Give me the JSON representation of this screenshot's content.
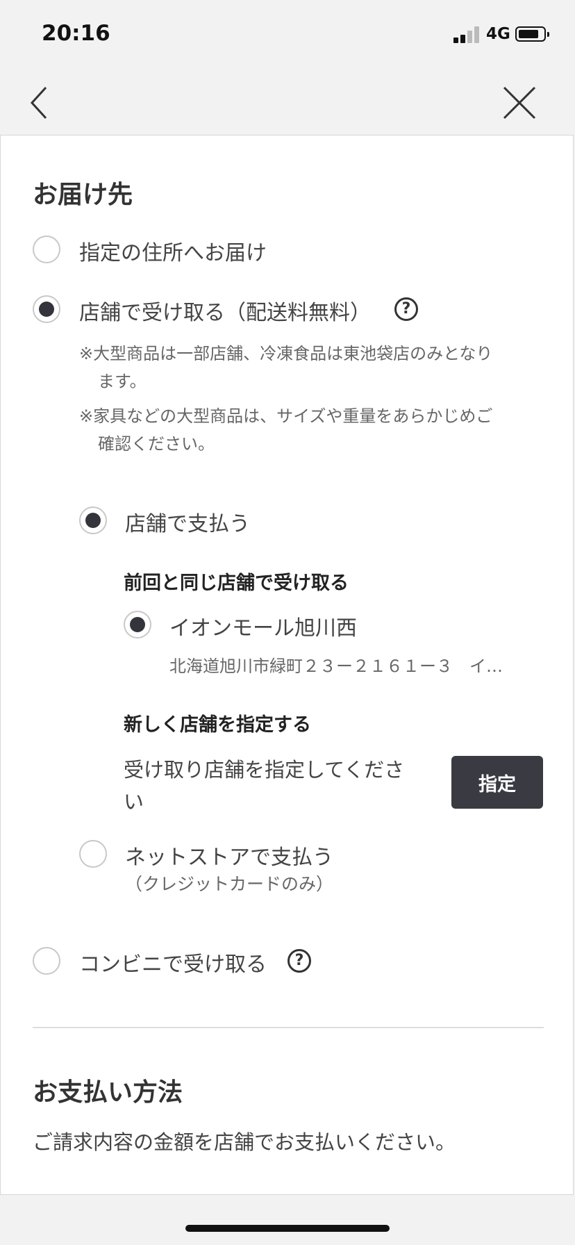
{
  "status_bar": {
    "time": "20:16",
    "network": "4G"
  },
  "delivery": {
    "title": "お届け先",
    "options": [
      {
        "label": "指定の住所へお届け",
        "selected": false
      },
      {
        "label": "店舗で受け取る（配送料無料）",
        "selected": true
      },
      {
        "label": "コンビニで受け取る",
        "selected": false
      }
    ],
    "notes": [
      [
        "※大型商品は一部店舗、冷凍食品は東池袋店のみとなり",
        "ます。"
      ],
      [
        "※家具などの大型商品は、サイズや重量をあらかじめご",
        "確認ください。"
      ]
    ],
    "payment_options": [
      {
        "label": "店舗で支払う",
        "selected": true
      },
      {
        "label": "ネットストアで支払う",
        "sub": "（クレジットカードのみ）",
        "selected": false
      }
    ],
    "same_store": {
      "heading": "前回と同じ店舗で受け取る",
      "store_name": "イオンモール旭川西",
      "address": "北海道旭川市緑町２３ー２１６１ー３　イ…",
      "selected": true
    },
    "new_store": {
      "heading": "新しく店舗を指定する",
      "prompt_line1": "受け取り店舗を指定してくださ",
      "prompt_line2": "い",
      "button_label": "指定"
    }
  },
  "payment_method": {
    "title": "お支払い方法",
    "description": "ご請求内容の金額を店舗でお支払いください。"
  },
  "icons": {
    "back": "chevron-left-icon",
    "close": "close-icon",
    "help": "question-circle-icon"
  },
  "colors": {
    "accent": "#34343c",
    "button_bg": "#3a3a42"
  }
}
